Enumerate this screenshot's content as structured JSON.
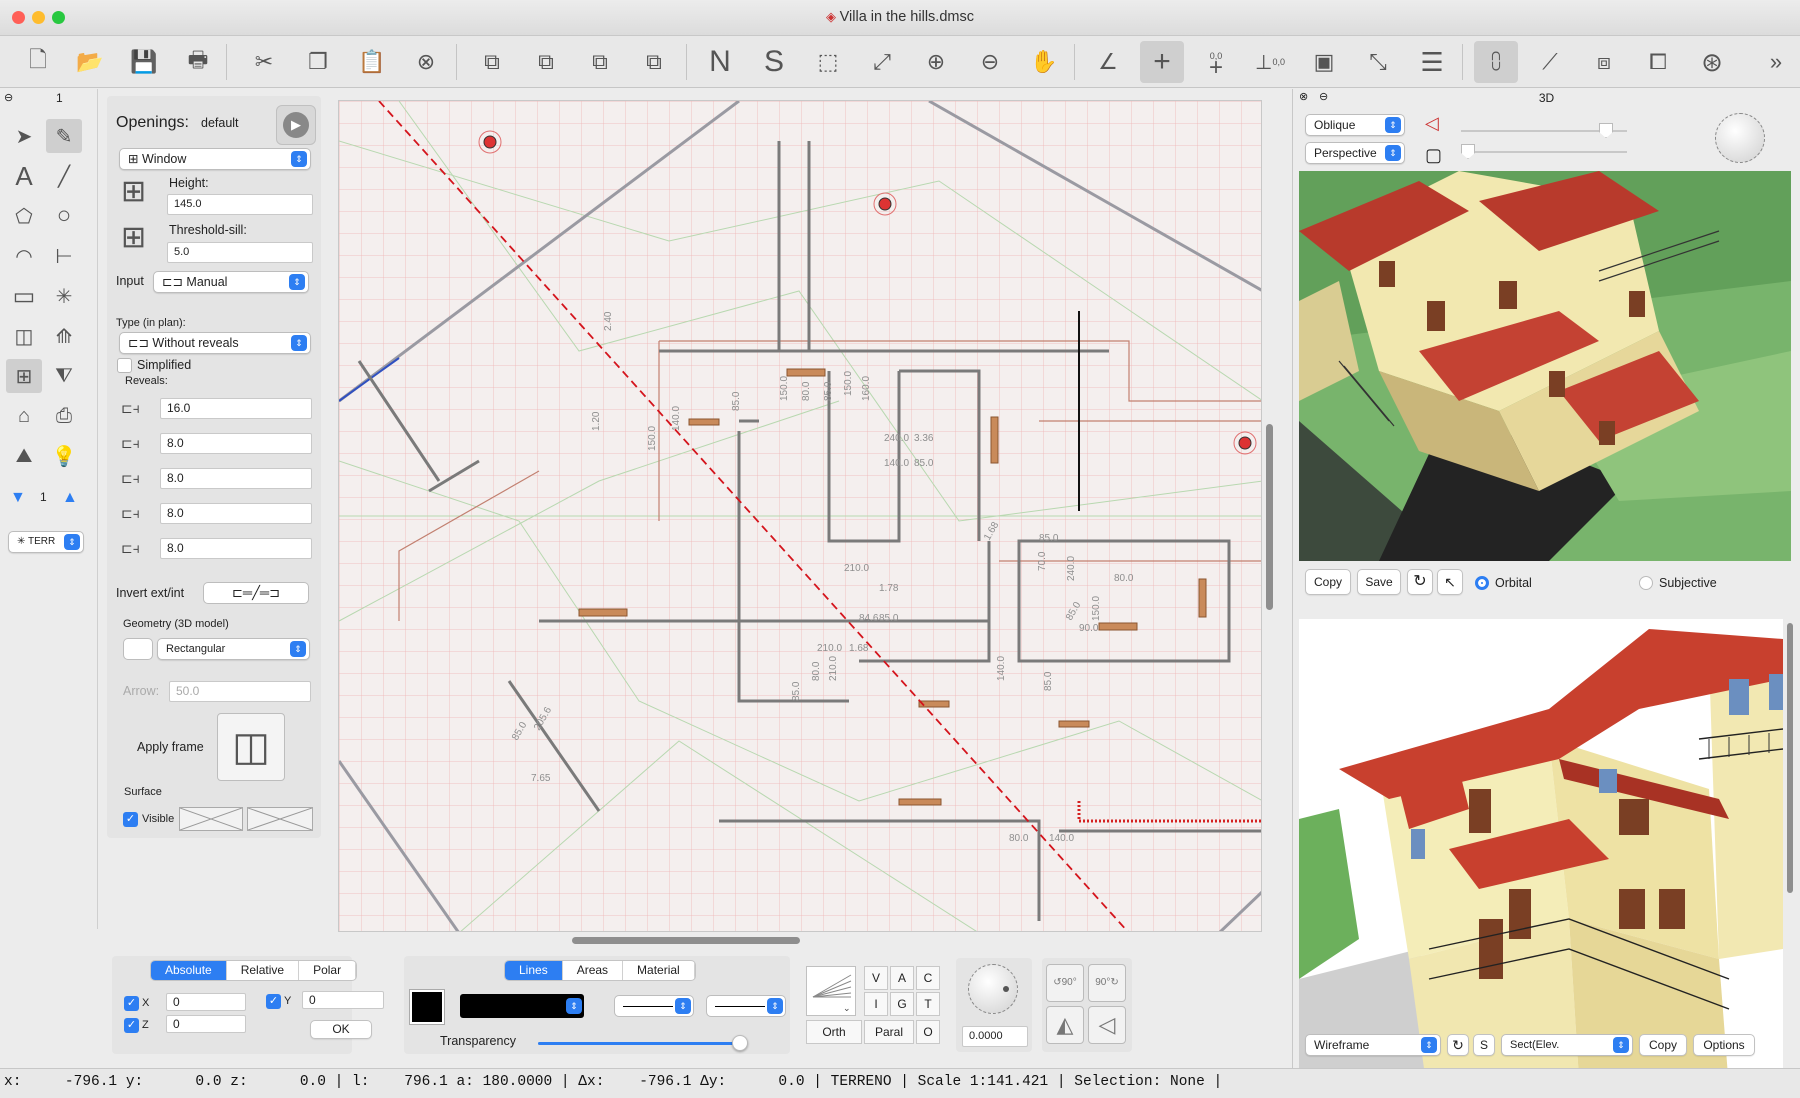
{
  "window": {
    "title": "Villa in the hills.dmsc",
    "traffic_lights": {
      "close": "#ff5f57",
      "minimize": "#febc2e",
      "zoom": "#28c840"
    }
  },
  "toolbar": {
    "items": [
      "new-document-icon",
      "open-folder-icon",
      "save-icon",
      "print-icon",
      "cut-icon",
      "copy-icon",
      "paste-icon",
      "delete-icon",
      "send-to-back-icon",
      "send-backward-icon",
      "bring-forward-icon",
      "bring-to-front-icon",
      "north-icon",
      "south-icon",
      "zoom-fit-selection-icon",
      "zoom-fit-all-icon",
      "zoom-in-icon",
      "zoom-out-icon",
      "pan-hand-icon",
      "angle-snap-icon",
      "crosshair-icon",
      "origin-icon",
      "ruler-icon",
      "layers-icon",
      "selection-filter-icon",
      "equal-lines-icon",
      "grid-snap-icon",
      "align-icon",
      "stack-icon",
      "boxes-icon",
      "wheel-icon",
      "more-icon"
    ],
    "labels": {
      "north": "N",
      "south": "S",
      "origin_label": "0,0",
      "ruler_label": "0,0",
      "more": "»"
    }
  },
  "left_tools": {
    "panel_number": "1",
    "level_value": "1",
    "layer_select": "TERR"
  },
  "properties": {
    "header": "Openings:",
    "preset": "default",
    "opening_type": "Window",
    "height_label": "Height:",
    "height_value": "145.0",
    "threshold_label": "Threshold-sill:",
    "threshold_value": "5.0",
    "input_label": "Input",
    "input_mode": "Manual",
    "type_in_plan_label": "Type (in plan):",
    "type_in_plan": "Without reveals",
    "simplified_label": "Simplified",
    "reveals_label": "Reveals:",
    "reveals": [
      "16.0",
      "8.0",
      "8.0",
      "8.0",
      "8.0"
    ],
    "invert_label": "Invert ext/int",
    "geometry_label": "Geometry (3D model)",
    "geometry_value": "Rectangular",
    "arrow_label": "Arrow:",
    "arrow_placeholder": "50.0",
    "apply_frame_label": "Apply frame",
    "surface_label": "Surface",
    "visible_label": "Visible"
  },
  "plan": {
    "dims": [
      "150.0",
      "80.0",
      "85.0",
      "150.0",
      "160.0",
      "240.0",
      "140.0",
      "3.36",
      "85.0",
      "210.0",
      "1.78",
      "84.6",
      "85.0",
      "210.0",
      "1.68",
      "80.0",
      "85.0",
      "210.0",
      "70.0",
      "240.0",
      "90.0",
      "80.0",
      "1.68",
      "85.0",
      "85.0",
      "150.0",
      "140.0",
      "85.0",
      "80.0",
      "140.0",
      "1.20",
      "2.40",
      "150.0",
      "140.0",
      "85.0",
      "7.65",
      "85.0",
      "205.6"
    ],
    "layer_colors": {
      "grid_red": "#f0b4b4",
      "grid_green": "#b8d8b0",
      "cut_line": "#d4141c",
      "walls": "#777777",
      "windows": "#b46a36"
    }
  },
  "coordinates": {
    "tabs": [
      "Absolute",
      "Relative",
      "Polar"
    ],
    "active_tab": "Absolute",
    "x_label": "X",
    "x_value": "0",
    "y_label": "Y",
    "y_value": "0",
    "z_label": "Z",
    "z_value": "0",
    "ok_label": "OK"
  },
  "style_panel": {
    "tabs": [
      "Lines",
      "Areas",
      "Material"
    ],
    "active_tab": "Lines",
    "transparency_label": "Transparency",
    "transparency_value": 0.96
  },
  "snap_panel": {
    "grid": [
      [
        "V",
        "A",
        "C"
      ],
      [
        "I",
        "G",
        "T"
      ]
    ],
    "orth": "Orth",
    "paral": "Paral",
    "o": "O"
  },
  "angle": {
    "value": "0.0000"
  },
  "rotate": {
    "left": "90°",
    "right": "90°"
  },
  "view3d": {
    "header": "3D",
    "projection": "Oblique",
    "mode": "Perspective",
    "copy_label": "Copy",
    "save_label": "Save",
    "orbital_label": "Orbital",
    "subjective_label": "Subjective",
    "render_mode": "Wireframe",
    "s_label": "S",
    "section_select": "Sect(Elev.",
    "copy2_label": "Copy",
    "options_label": "Options"
  },
  "status": {
    "text": "x:     -796.1 y:      0.0 z:      0.0 | l:    796.1 a: 180.0000 | Δx:    -796.1 Δy:      0.0 | TERRENO | Scale 1:141.421 | Selection: None |"
  }
}
